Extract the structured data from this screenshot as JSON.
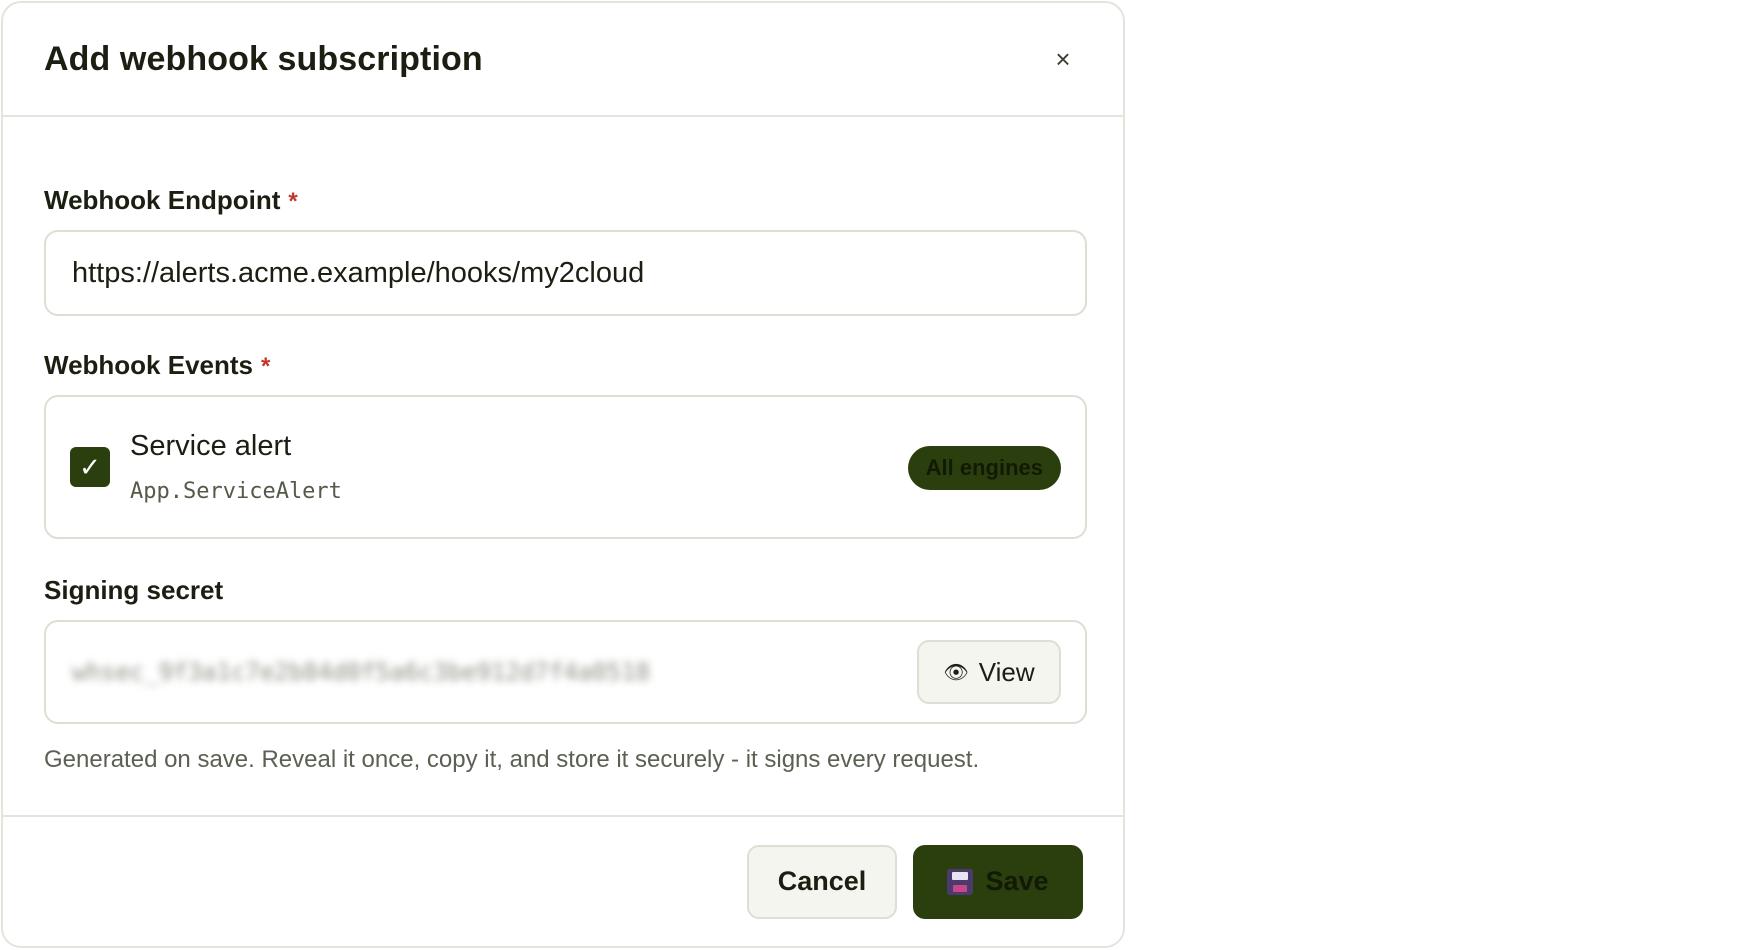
{
  "dialog": {
    "title": "Add webhook subscription",
    "close_icon": "close-icon",
    "close_glyph": "×"
  },
  "endpoint": {
    "label": "Webhook Endpoint",
    "required_mark": "*",
    "value": "https://alerts.acme.example/hooks/my2cloud"
  },
  "events": {
    "label": "Webhook Events",
    "required_mark": "*",
    "items": [
      {
        "checked": true,
        "check_glyph": "✓",
        "title": "Service alert",
        "code": "App.ServiceAlert",
        "scope": "All engines"
      }
    ]
  },
  "secret": {
    "label": "Signing secret",
    "masked_value": "whsec_9f3a1c7e2b84d0f5a6c3be912d7f4a0518",
    "view_label": "View",
    "view_icon": "eye-icon",
    "view_glyph": "👁",
    "hint": "Generated on save. Reveal it once, copy it, and store it securely - it signs every request."
  },
  "footer": {
    "cancel_label": "Cancel",
    "save_label": "Save",
    "save_icon": "floppy-disk-icon"
  },
  "colors": {
    "accent": "#2b3f0e",
    "required": "#c0392b",
    "border": "#dcdfd4"
  }
}
